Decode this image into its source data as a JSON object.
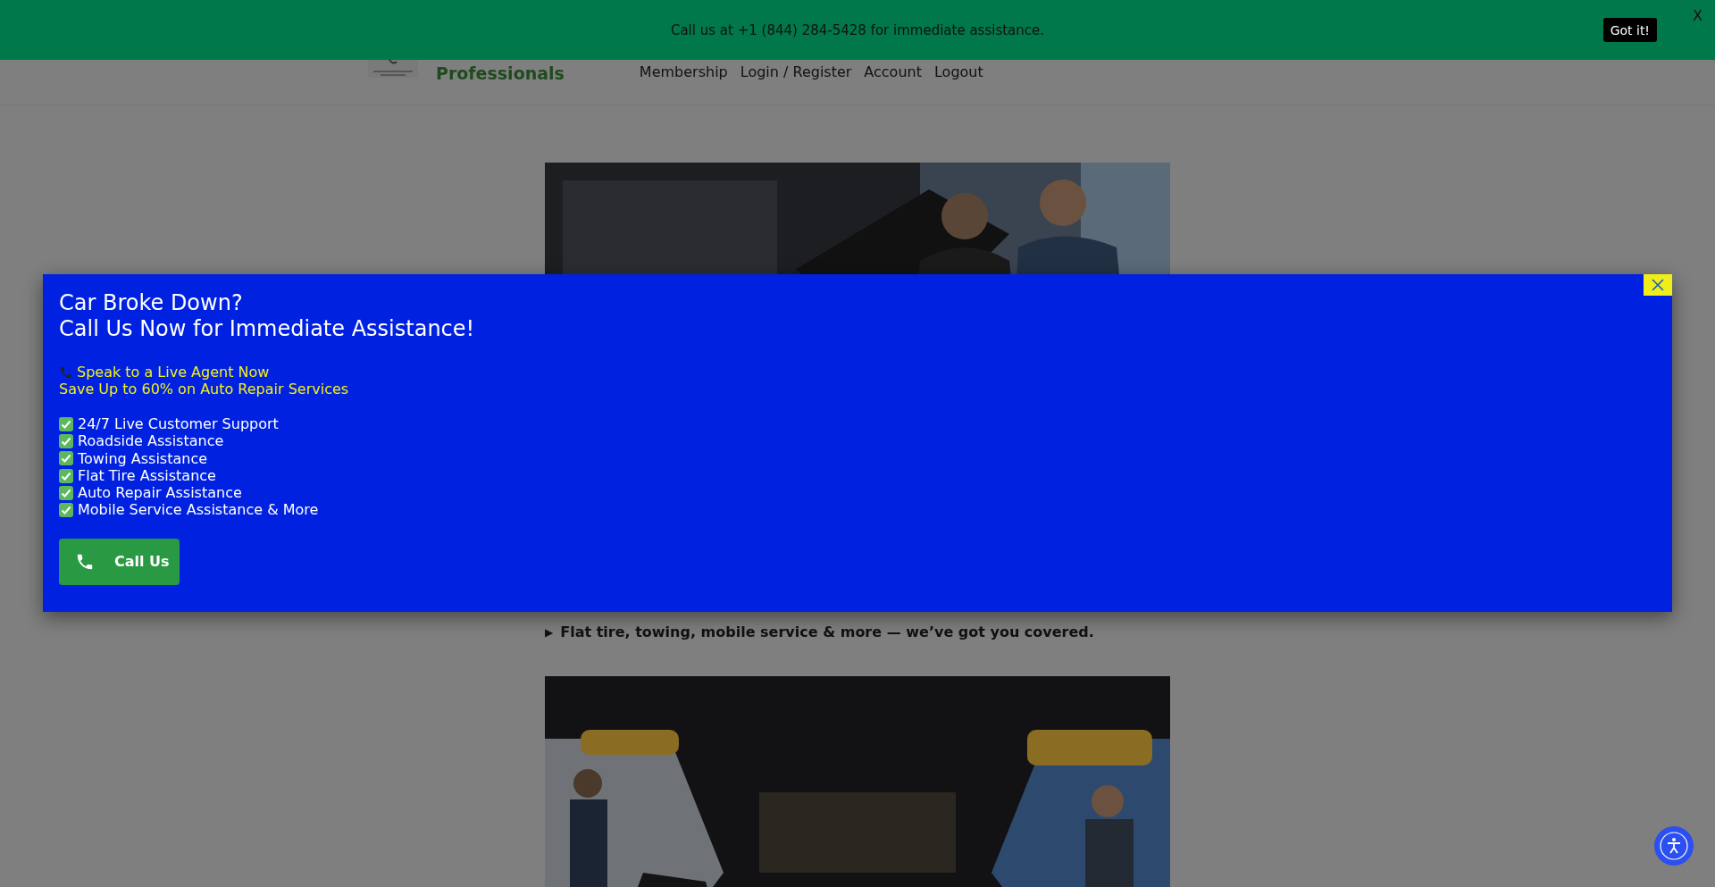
{
  "announcement": {
    "text": "Call us at +1 (844) 284-5428 for immediate assistance.",
    "button": "Got it!",
    "close": "X"
  },
  "header": {
    "brand": "Professionals",
    "nav": [
      "Membership",
      "Login / Register",
      "Account",
      "Logout"
    ]
  },
  "content": {
    "marker": "▶",
    "caption": "Flat tire, towing, mobile service & more — we’ve got you covered."
  },
  "popup": {
    "title_lines": [
      "Car Broke Down?",
      "Call Us Now for Immediate Assistance!"
    ],
    "highlight_lines": [
      "Speak to a Live Agent Now",
      "Save Up to 60% on Auto Repair Services"
    ],
    "features": [
      "24/7 Live Customer Support",
      "Roadside Assistance",
      "Towing Assistance",
      "Flat Tire Assistance",
      "Auto Repair Assistance",
      "Mobile Service Assistance & More"
    ],
    "button": "Call Us"
  }
}
